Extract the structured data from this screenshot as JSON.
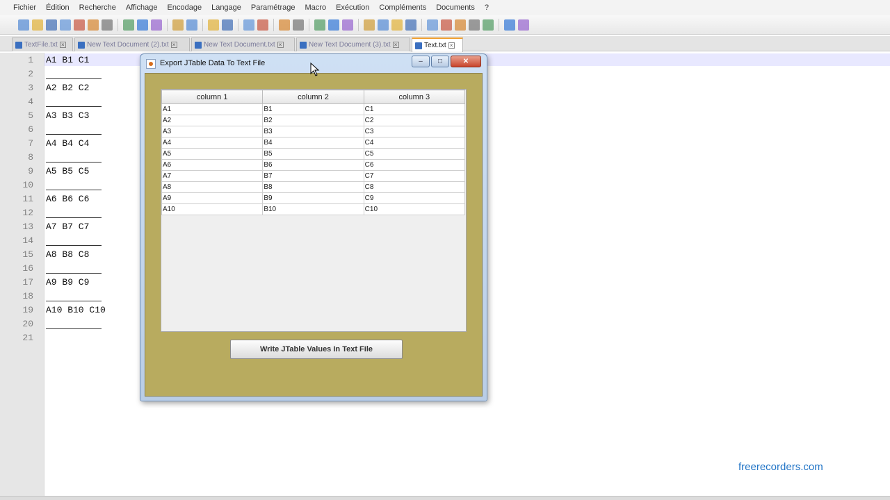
{
  "menu": [
    "Fichier",
    "Édition",
    "Recherche",
    "Affichage",
    "Encodage",
    "Langage",
    "Paramétrage",
    "Macro",
    "Exécution",
    "Compléments",
    "Documents",
    "?"
  ],
  "tabs": [
    {
      "label": "TextFile.txt",
      "active": false
    },
    {
      "label": "New Text Document (2).txt",
      "active": false
    },
    {
      "label": "New Text Document.txt",
      "active": false
    },
    {
      "label": "New Text Document (3).txt",
      "active": false
    },
    {
      "label": "Text.txt",
      "active": true
    }
  ],
  "editor": {
    "lines": [
      {
        "n": "1",
        "text": "A1 B1 C1"
      },
      {
        "n": "2",
        "text": "",
        "rule": true
      },
      {
        "n": "3",
        "text": "A2 B2 C2"
      },
      {
        "n": "4",
        "text": "",
        "rule": true
      },
      {
        "n": "5",
        "text": "A3 B3 C3"
      },
      {
        "n": "6",
        "text": "",
        "rule": true
      },
      {
        "n": "7",
        "text": "A4 B4 C4"
      },
      {
        "n": "8",
        "text": "",
        "rule": true
      },
      {
        "n": "9",
        "text": "A5 B5 C5"
      },
      {
        "n": "10",
        "text": "",
        "rule": true
      },
      {
        "n": "11",
        "text": "A6 B6 C6"
      },
      {
        "n": "12",
        "text": "",
        "rule": true
      },
      {
        "n": "13",
        "text": "A7 B7 C7"
      },
      {
        "n": "14",
        "text": "",
        "rule": true
      },
      {
        "n": "15",
        "text": "A8 B8 C8"
      },
      {
        "n": "16",
        "text": "",
        "rule": true
      },
      {
        "n": "17",
        "text": "A9 B9 C9"
      },
      {
        "n": "18",
        "text": "",
        "rule": true
      },
      {
        "n": "19",
        "text": "A10 B10 C10"
      },
      {
        "n": "20",
        "text": "",
        "rule": true
      },
      {
        "n": "21",
        "text": ""
      }
    ]
  },
  "dialog": {
    "title": "Export JTable Data To Text File",
    "columns": [
      "column 1",
      "column 2",
      "column 3"
    ],
    "rows": [
      [
        "A1",
        "B1",
        "C1"
      ],
      [
        "A2",
        "B2",
        "C2"
      ],
      [
        "A3",
        "B3",
        "C3"
      ],
      [
        "A4",
        "B4",
        "C4"
      ],
      [
        "A5",
        "B5",
        "C5"
      ],
      [
        "A6",
        "B6",
        "C6"
      ],
      [
        "A7",
        "B7",
        "C7"
      ],
      [
        "A8",
        "B8",
        "C8"
      ],
      [
        "A9",
        "B9",
        "C9"
      ],
      [
        "A10",
        "B10",
        "C10"
      ]
    ],
    "button_label": "Write JTable Values In Text File",
    "body_color": "#b8ab5f"
  },
  "watermark": "freerecorders.com",
  "colors": {
    "accent_tab": "#f0a030",
    "watermark": "#1f73c6"
  }
}
